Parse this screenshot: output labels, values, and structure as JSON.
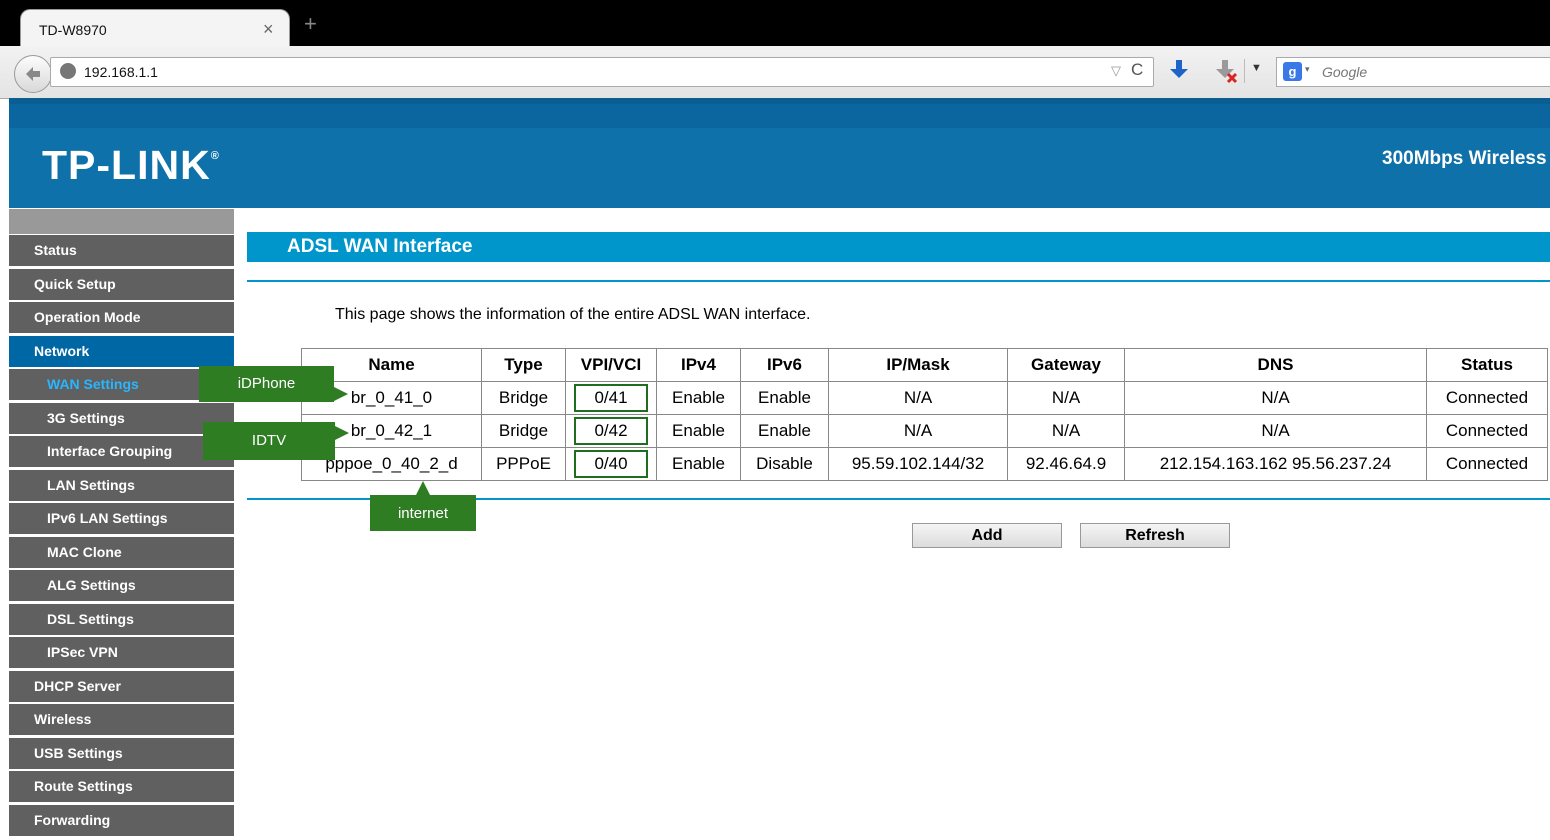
{
  "browser": {
    "tab_title": "TD-W8970",
    "tab_close": "×",
    "new_tab": "+",
    "url": "192.168.1.1",
    "url_dropdown": "▽",
    "reload": "C",
    "toolbar_dropdown": "▼",
    "search_engine_letter": "g",
    "search_dropdown": "▾",
    "search_placeholder": "Google"
  },
  "header": {
    "logo": "TP-LINK",
    "logo_mark": "®",
    "model": "300Mbps Wireless"
  },
  "sidebar": {
    "items": [
      {
        "label": "Status"
      },
      {
        "label": "Quick Setup"
      },
      {
        "label": "Operation Mode"
      },
      {
        "label": "Network"
      },
      {
        "label": "WAN Settings"
      },
      {
        "label": "3G Settings"
      },
      {
        "label": "Interface Grouping"
      },
      {
        "label": "LAN Settings"
      },
      {
        "label": "IPv6 LAN Settings"
      },
      {
        "label": "MAC Clone"
      },
      {
        "label": "ALG Settings"
      },
      {
        "label": "DSL Settings"
      },
      {
        "label": "IPSec VPN"
      },
      {
        "label": "DHCP Server"
      },
      {
        "label": "Wireless"
      },
      {
        "label": "USB Settings"
      },
      {
        "label": "Route Settings"
      },
      {
        "label": "Forwarding"
      }
    ]
  },
  "main": {
    "title": "ADSL WAN Interface",
    "description": "This page shows the information of the entire ADSL WAN interface.",
    "table": {
      "headers": [
        "Name",
        "Type",
        "VPI/VCI",
        "IPv4",
        "IPv6",
        "IP/Mask",
        "Gateway",
        "DNS",
        "Status"
      ],
      "rows": [
        {
          "name": "br_0_41_0",
          "type": "Bridge",
          "vpi": "0/41",
          "ipv4": "Enable",
          "ipv6": "Enable",
          "ipmask": "N/A",
          "gateway": "N/A",
          "dns": "N/A",
          "status": "Connected"
        },
        {
          "name": "br_0_42_1",
          "type": "Bridge",
          "vpi": "0/42",
          "ipv4": "Enable",
          "ipv6": "Enable",
          "ipmask": "N/A",
          "gateway": "N/A",
          "dns": "N/A",
          "status": "Connected"
        },
        {
          "name": "pppoe_0_40_2_d",
          "type": "PPPoE",
          "vpi": "0/40",
          "ipv4": "Enable",
          "ipv6": "Disable",
          "ipmask": "95.59.102.144/32",
          "gateway": "92.46.64.9",
          "dns": "212.154.163.162 95.56.237.24",
          "status": "Connected"
        }
      ]
    },
    "buttons": {
      "add": "Add",
      "refresh": "Refresh"
    }
  },
  "callouts": {
    "idphone": "iDPhone",
    "idtv": "IDTV",
    "internet": "internet"
  },
  "colors": {
    "header_blue": "#0f71a9",
    "title_blue": "#0096cc",
    "sidebar_gray": "#606060",
    "sidebar_active": "#0067a5",
    "sidebar_current_text": "#29b6ff",
    "callout_green": "#2e7d23"
  }
}
